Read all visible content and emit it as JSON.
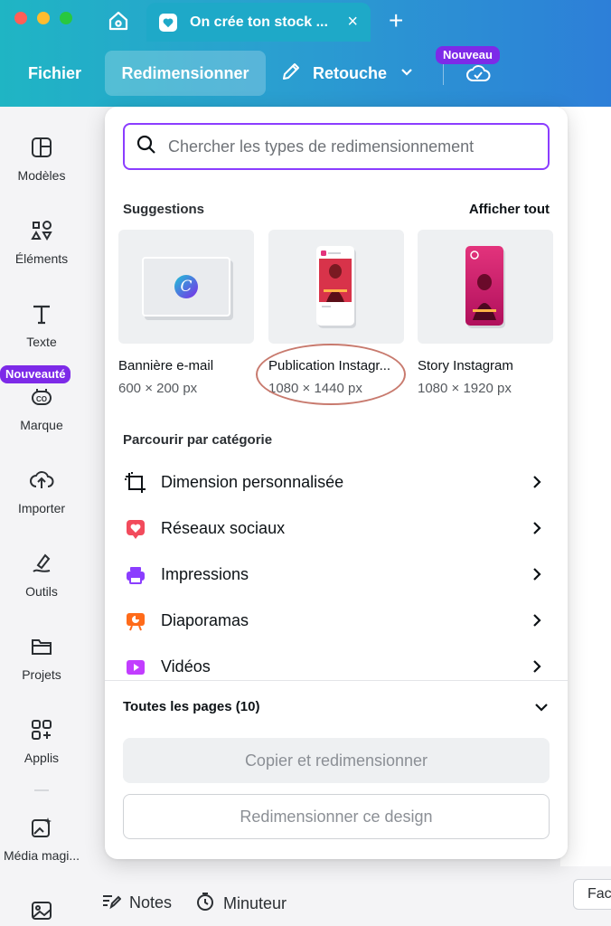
{
  "browser": {
    "tab_title": "On crée ton stock ...",
    "tab_close": "×",
    "new_tab": "+"
  },
  "toolbar": {
    "fichier": "Fichier",
    "redimensionner": "Redimensionner",
    "retouche": "Retouche",
    "nouveau_badge": "Nouveau"
  },
  "sidebar": {
    "items": [
      {
        "label": "Modèles",
        "icon": "layout-icon"
      },
      {
        "label": "Éléments",
        "icon": "shapes-icon"
      },
      {
        "label": "Texte",
        "icon": "text-icon"
      },
      {
        "label": "Marque",
        "icon": "brand-icon"
      },
      {
        "label": "Importer",
        "icon": "upload-cloud-icon"
      },
      {
        "label": "Outils",
        "icon": "pen-tool-icon"
      },
      {
        "label": "Projets",
        "icon": "folder-icon"
      },
      {
        "label": "Applis",
        "icon": "apps-icon"
      },
      {
        "label": "Média magi...",
        "icon": "magic-media-icon"
      }
    ],
    "nouveaute_badge": "Nouveauté"
  },
  "panel": {
    "search_placeholder": "Chercher les types de redimensionnement",
    "suggestions_title": "Suggestions",
    "show_all": "Afficher tout",
    "suggestions": [
      {
        "name": "Bannière e-mail",
        "dims": "600 × 200 px"
      },
      {
        "name": "Publication Instagr...",
        "dims": "1080 × 1440 px"
      },
      {
        "name": "Story Instagram",
        "dims": "1080 × 1920 px"
      }
    ],
    "browse_title": "Parcourir par catégorie",
    "categories": [
      {
        "label": "Dimension personnalisée",
        "icon": "custom-size-icon"
      },
      {
        "label": "Réseaux sociaux",
        "icon": "social-heart-icon",
        "color": "#f24b5c"
      },
      {
        "label": "Impressions",
        "icon": "printer-icon",
        "color": "#8b3dff"
      },
      {
        "label": "Diaporamas",
        "icon": "presentation-icon",
        "color": "#ff6b1a"
      },
      {
        "label": "Vidéos",
        "icon": "video-icon",
        "color": "#c23dff"
      }
    ],
    "all_pages": "Toutes les pages (10)",
    "copy_resize": "Copier et redimensionner",
    "resize_design": "Redimensionner ce design"
  },
  "bottombar": {
    "notes": "Notes",
    "minuteur": "Minuteur",
    "fac": "Fac"
  },
  "colors": {
    "accent": "#8b3dff",
    "badge": "#7d2ae8",
    "header_gradient_start": "#1fb5c4",
    "header_gradient_end": "#2d7fd8"
  }
}
